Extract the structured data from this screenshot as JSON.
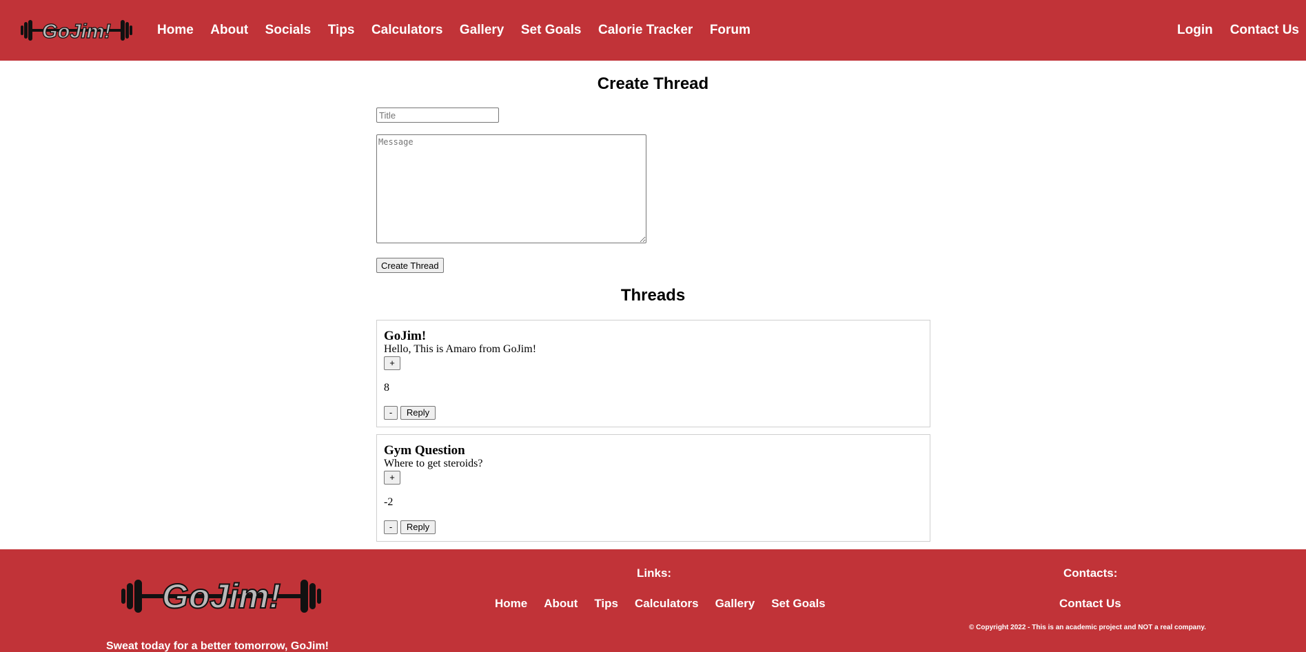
{
  "brand": {
    "logo_text": "GoJim!",
    "accent_color": "#c13338"
  },
  "nav": {
    "left": [
      {
        "label": "Home"
      },
      {
        "label": "About"
      },
      {
        "label": "Socials"
      },
      {
        "label": "Tips"
      },
      {
        "label": "Calculators"
      },
      {
        "label": "Gallery"
      },
      {
        "label": "Set Goals"
      },
      {
        "label": "Calorie Tracker"
      },
      {
        "label": "Forum"
      }
    ],
    "right": [
      {
        "label": "Login"
      },
      {
        "label": "Contact Us"
      }
    ]
  },
  "create": {
    "heading": "Create Thread",
    "title_placeholder": "Title",
    "title_value": "",
    "message_placeholder": "Message",
    "message_value": "",
    "button_label": "Create Thread"
  },
  "threads": {
    "heading": "Threads",
    "items": [
      {
        "title": "GoJim!",
        "message": "Hello, This is Amaro from GoJim!",
        "upvote_label": "+",
        "score": "8",
        "downvote_label": "-",
        "reply_label": "Reply"
      },
      {
        "title": "Gym Question",
        "message": "Where to get steroids?",
        "upvote_label": "+",
        "score": "-2",
        "downvote_label": "-",
        "reply_label": "Reply"
      }
    ]
  },
  "footer": {
    "tagline": "Sweat today for a better tomorrow, GoJim!",
    "links_heading": "Links:",
    "links": [
      {
        "label": "Home"
      },
      {
        "label": "About"
      },
      {
        "label": "Tips"
      },
      {
        "label": "Calculators"
      },
      {
        "label": "Gallery"
      },
      {
        "label": "Set Goals"
      }
    ],
    "contacts_heading": "Contacts:",
    "contact_link": "Contact Us",
    "copyright": "© Copyright 2022 - This is an academic project and NOT a real company."
  }
}
